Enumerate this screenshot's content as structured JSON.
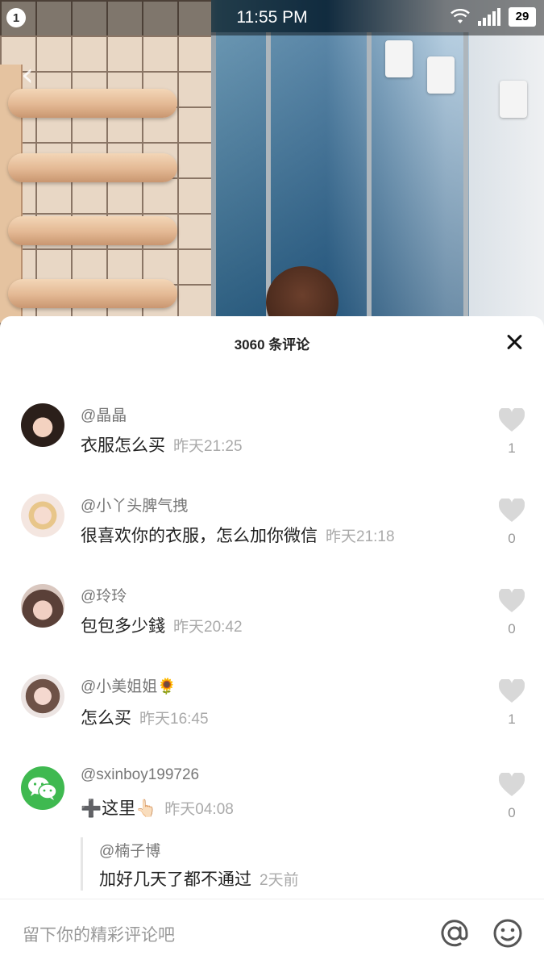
{
  "status_bar": {
    "notification_count": "1",
    "time": "11:55 PM",
    "battery": "29"
  },
  "panel": {
    "title": "3060 条评论"
  },
  "comments": [
    {
      "author": "@晶晶",
      "text": "衣服怎么买",
      "time": "昨天21:25",
      "likes": "1"
    },
    {
      "author": "@小丫头脾气拽",
      "text": "很喜欢你的衣服，怎么加你微信",
      "time": "昨天21:18",
      "likes": "0"
    },
    {
      "author": "@玲玲",
      "text": "包包多少錢",
      "time": "昨天20:42",
      "likes": "0"
    },
    {
      "author": "@小美姐姐🌻",
      "text": "怎么买",
      "time": "昨天16:45",
      "likes": "1"
    },
    {
      "author": "@sxinboy199726",
      "text": "➕这里👆🏻",
      "time": "昨天04:08",
      "likes": "0"
    }
  ],
  "reply": {
    "author": "@楠子博",
    "text": "加好几天了都不通过",
    "time": "2天前"
  },
  "input": {
    "placeholder": "留下你的精彩评论吧"
  },
  "icons": {
    "close": "close-icon",
    "like": "heart-icon",
    "mention": "at-icon",
    "emoji": "emoji-icon",
    "back": "back-arrow-icon",
    "wifi": "wifi-icon",
    "signal": "signal-icon"
  },
  "colors": {
    "panel_bg": "#ffffff",
    "heart": "#d8d8d8",
    "wechat_green": "#3fb950"
  }
}
